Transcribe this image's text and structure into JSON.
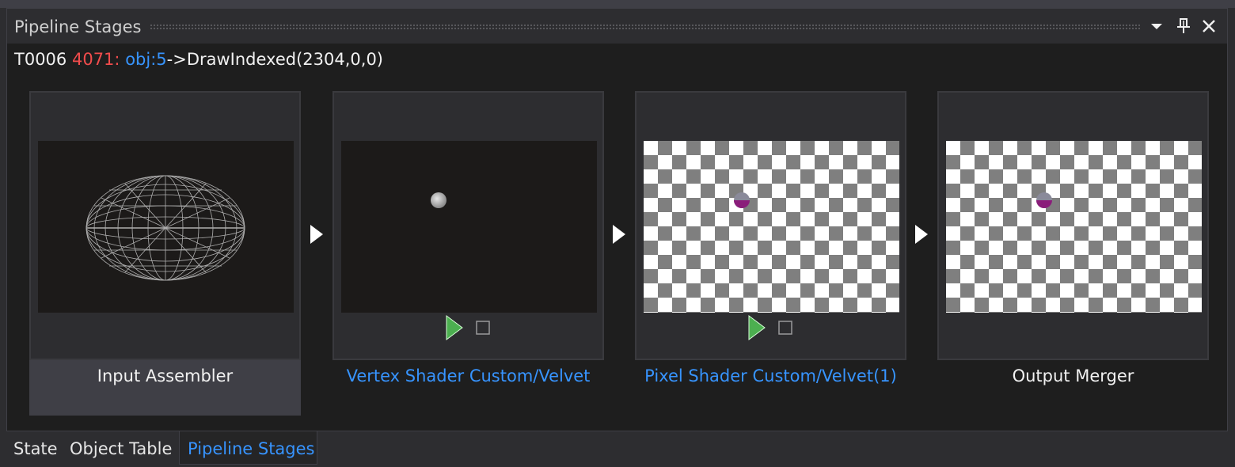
{
  "panel": {
    "title": "Pipeline Stages"
  },
  "event": {
    "thread": "T0006",
    "event_id": "4071:",
    "object": "obj:5",
    "separator": "->",
    "call": "DrawIndexed(2304,0,0)"
  },
  "stages": [
    {
      "label": "Input Assembler",
      "selected": true,
      "link": false,
      "thumbnail": "wireframe-sphere"
    },
    {
      "label": "Vertex Shader Custom/Velvet",
      "selected": false,
      "link": true,
      "thumbnail": "small-sphere"
    },
    {
      "label": "Pixel Shader Custom/Velvet(1)",
      "selected": false,
      "link": true,
      "thumbnail": "transparent-checker"
    },
    {
      "label": "Output Merger",
      "selected": false,
      "link": false,
      "thumbnail": "transparent-checker"
    }
  ],
  "tabs": [
    {
      "label": "State",
      "active": false
    },
    {
      "label": "Object Table",
      "active": false
    },
    {
      "label": "Pipeline Stages",
      "active": true
    }
  ],
  "icons": {
    "dropdown": "chevron-down-icon",
    "pin": "pin-icon",
    "close": "close-icon",
    "play": "play-icon",
    "stop": "stop-icon",
    "stage_arrow": "arrow-right-icon"
  },
  "colors": {
    "background": "#1e1e1e",
    "link": "#3794ff",
    "event_id": "#f14c4c",
    "play": "#4caf50",
    "selected_stage": "#3f3f46"
  }
}
